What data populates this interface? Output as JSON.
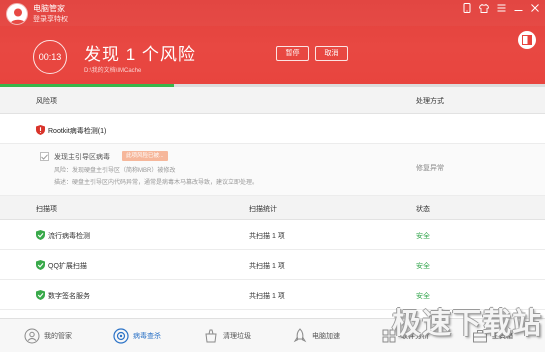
{
  "header": {
    "app_name": "电脑管家",
    "login_hint": "登录享特权",
    "timer": "00:13",
    "title": "发现 1 个风险",
    "scan_path": "D:\\我的文档\\IMCache",
    "pause_label": "暂停",
    "cancel_label": "取消",
    "progress_percent": 32
  },
  "risk_table": {
    "col_item": "风险项",
    "col_action": "处理方式",
    "group_title": "Rootkit病毒检测(1)",
    "detail": {
      "title": "发现主引导区病毒",
      "badge": "此项风险已被...",
      "risk_line": "风险：发现硬盘主引导区（简称MBR）被修改",
      "desc_line": "描述：硬盘主引导区内代码异常，通常是病毒木马篡改导致，建议立即处理。",
      "action": "修复异常"
    }
  },
  "scan_table": {
    "col_item": "扫描项",
    "col_stat": "扫描统计",
    "col_state": "状态",
    "rows": [
      {
        "name": "流行病毒检测",
        "stat": "共扫描 1 项",
        "state": "安全"
      },
      {
        "name": "QQ扩展扫描",
        "stat": "共扫描 1 项",
        "state": "安全"
      },
      {
        "name": "数字签名服务",
        "stat": "共扫描 1 项",
        "state": "安全"
      }
    ]
  },
  "bottom_nav": [
    {
      "label": "我的管家",
      "icon": "home-icon"
    },
    {
      "label": "病毒查杀",
      "icon": "virus-scan-icon",
      "active": true
    },
    {
      "label": "清理垃圾",
      "icon": "clean-icon"
    },
    {
      "label": "电脑加速",
      "icon": "rocket-icon"
    },
    {
      "label": "软件分析",
      "icon": "software-icon"
    },
    {
      "label": "工具箱",
      "icon": "toolbox-icon"
    }
  ],
  "watermark": "极速下载站",
  "colors": {
    "header_red": "#e8443e",
    "progress_green": "#39b54a",
    "safe_green": "#2fa54a",
    "risk_red": "#d9342b",
    "active_blue": "#2c73c7"
  }
}
